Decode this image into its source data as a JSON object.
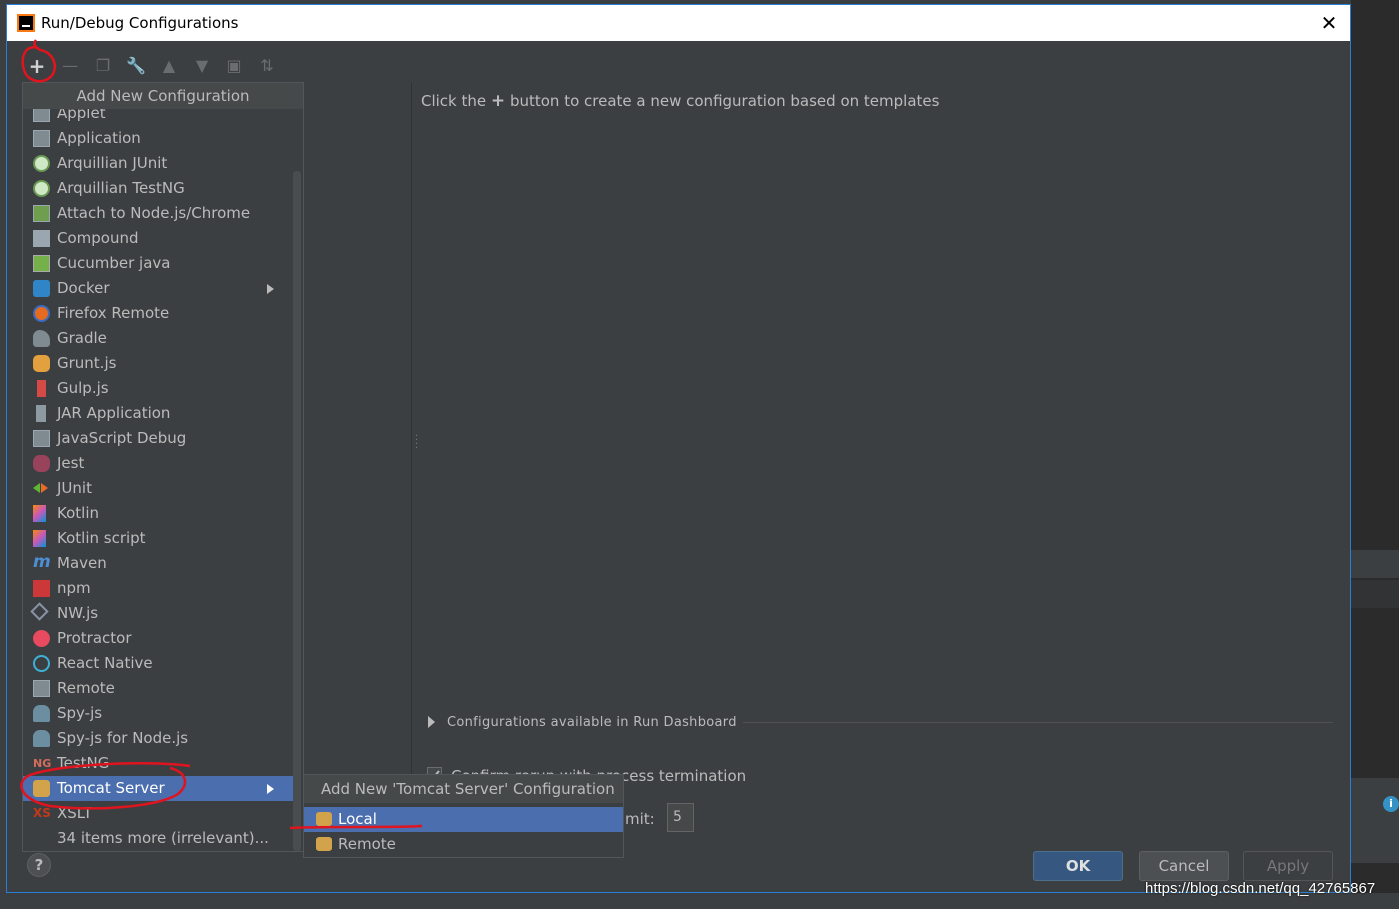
{
  "dialog": {
    "title": "Run/Debug Configurations",
    "close_label": "✕"
  },
  "toolbar": {
    "icons": [
      "add-icon",
      "remove-icon",
      "copy-icon",
      "wrench-icon",
      "move-up-icon",
      "move-down-icon",
      "folder-icon",
      "sort-icon"
    ]
  },
  "hint": {
    "before": "Click the",
    "plus": "+",
    "after": "button to create a new configuration based on templates"
  },
  "popup": {
    "header": "Add New Configuration",
    "items": [
      {
        "label": "Applet",
        "icon": "applet-icon"
      },
      {
        "label": "Application",
        "icon": "application-icon"
      },
      {
        "label": "Arquillian JUnit",
        "icon": "arquillian-icon"
      },
      {
        "label": "Arquillian TestNG",
        "icon": "arquillian-icon"
      },
      {
        "label": "Attach to Node.js/Chrome",
        "icon": "nodejs-icon"
      },
      {
        "label": "Compound",
        "icon": "compound-icon"
      },
      {
        "label": "Cucumber java",
        "icon": "cucumber-icon"
      },
      {
        "label": "Docker",
        "icon": "docker-icon"
      },
      {
        "label": "Firefox Remote",
        "icon": "firefox-icon"
      },
      {
        "label": "Gradle",
        "icon": "gradle-icon"
      },
      {
        "label": "Grunt.js",
        "icon": "grunt-icon"
      },
      {
        "label": "Gulp.js",
        "icon": "gulp-icon"
      },
      {
        "label": "JAR Application",
        "icon": "jar-icon"
      },
      {
        "label": "JavaScript Debug",
        "icon": "javascript-debug-icon"
      },
      {
        "label": "Jest",
        "icon": "jest-icon"
      },
      {
        "label": "JUnit",
        "icon": "junit-icon"
      },
      {
        "label": "Kotlin",
        "icon": "kotlin-icon"
      },
      {
        "label": "Kotlin script",
        "icon": "kotlin-icon"
      },
      {
        "label": "Maven",
        "icon": "maven-icon"
      },
      {
        "label": "npm",
        "icon": "npm-icon"
      },
      {
        "label": "NW.js",
        "icon": "nwjs-icon"
      },
      {
        "label": "Protractor",
        "icon": "protractor-icon"
      },
      {
        "label": "React Native",
        "icon": "react-icon"
      },
      {
        "label": "Remote",
        "icon": "remote-icon"
      },
      {
        "label": "Spy-js",
        "icon": "spyjs-icon"
      },
      {
        "label": "Spy-js for Node.js",
        "icon": "spyjs-icon"
      },
      {
        "label": "TestNG",
        "icon": "testng-icon"
      },
      {
        "label": "Tomcat Server",
        "icon": "tomcat-icon"
      },
      {
        "label": "XSLT",
        "icon": "xslt-icon"
      },
      {
        "label": "34 items more (irrelevant)...",
        "icon": ""
      }
    ]
  },
  "submenu": {
    "header": "Add New 'Tomcat Server' Configuration",
    "items": [
      {
        "label": "Local"
      },
      {
        "label": "Remote"
      }
    ]
  },
  "dashboard": {
    "label": "Configurations available in Run Dashboard"
  },
  "confirm": {
    "label": "Confirm rerun with process termination"
  },
  "limit": {
    "label": "mit:",
    "value": "5"
  },
  "buttons": {
    "ok": "OK",
    "cancel": "Cancel",
    "apply": "Apply",
    "help": "?"
  },
  "watermark": "https://blog.csdn.net/qq_42765867",
  "colors": {
    "selection": "#4b6eaf",
    "annotation": "#e0141e",
    "ok_button": "#365880"
  }
}
